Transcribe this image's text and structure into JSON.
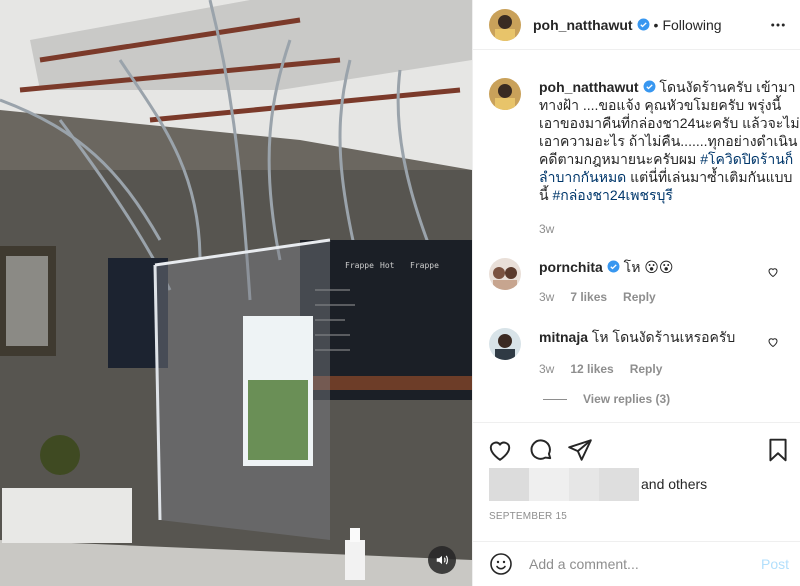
{
  "post": {
    "author": "poh_natthawut",
    "follow_status": "Following",
    "separator": "•",
    "caption_text": " โดนงัดร้านครับ เข้ามาทางฝ้า ....ขอแจ้ง คุณหัวขโมยครับ พรุ่งนี้เอาของมาคืนที่กล่องชา24นะครับ แล้วจะไม่เอาความอะไร ถ้าไม่คืน.......ทุกอย่างดำเนินคดีตามกฎหมายนะครับผม ",
    "hashtag_1": "#โควิดปิดร้านก็ลำบากกันหมด",
    "caption_middle": " แต่นี่ที่เล่นมาซ้ำเติมกันแบบนี้ ",
    "hashtag_2": "#กล่องชา24เพชรบุรี",
    "caption_time": "3w"
  },
  "comments": [
    {
      "username": "pornchita",
      "text": " โห 😮😮",
      "time": "3w",
      "likes": "7 likes",
      "reply": "Reply"
    },
    {
      "username": "mitnaja",
      "text": " โห โดนงัดร้านเหรอครับ",
      "time": "3w",
      "likes": "12 likes",
      "reply": "Reply"
    }
  ],
  "view_replies": "View replies (3)",
  "likes": {
    "and_others": "and others"
  },
  "date": "SEPTEMBER 15",
  "add_comment": {
    "placeholder": "Add a comment...",
    "post_label": "Post"
  },
  "colors": {
    "link": "#00376b",
    "muted": "#8e8e8e",
    "verified": "#3897f0",
    "post_disabled": "#b2dffc"
  },
  "icons": [
    "more-icon",
    "verified-icon",
    "heart-icon",
    "comment-icon",
    "share-icon",
    "bookmark-icon",
    "emoji-icon",
    "mute-icon"
  ]
}
